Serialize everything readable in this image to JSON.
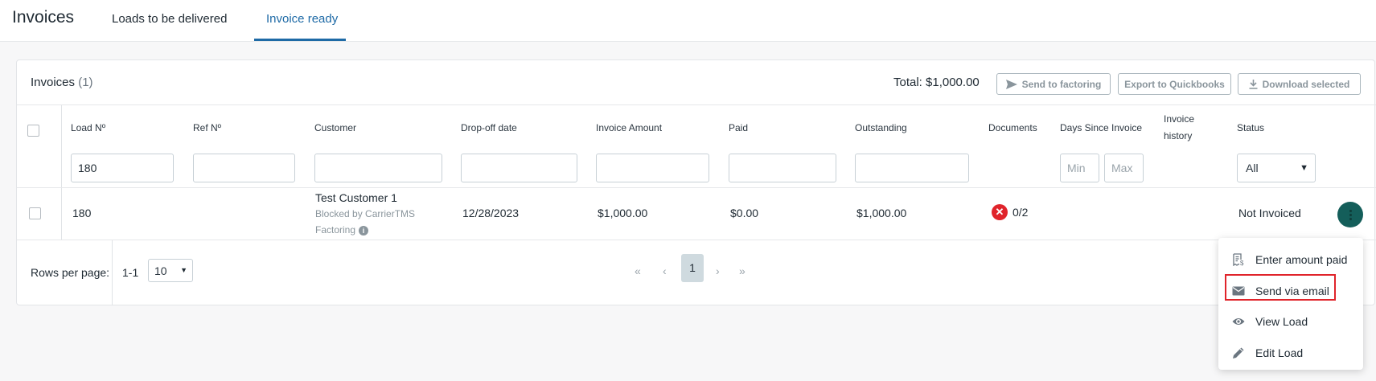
{
  "header": {
    "title": "Invoices",
    "tabs": [
      {
        "label": "Loads to be delivered",
        "active": false
      },
      {
        "label": "Invoice ready",
        "active": true
      }
    ]
  },
  "card": {
    "title": "Invoices",
    "count": "(1)",
    "total": "Total: $1,000.00",
    "buttons": {
      "send_to_factoring": "Send to factoring",
      "export_quickbooks": "Export to Quickbooks",
      "download_selected": "Download selected"
    }
  },
  "table": {
    "columns": {
      "load_no": "Load Nº",
      "ref_no": "Ref Nº",
      "customer": "Customer",
      "dropoff": "Drop-off date",
      "invoice_amount": "Invoice Amount",
      "paid": "Paid",
      "outstanding": "Outstanding",
      "documents": "Documents",
      "days_since": "Days Since Invoice",
      "history_line1": "Invoice",
      "history_line2": "history",
      "status": "Status"
    },
    "filters": {
      "load_no": "180",
      "ref_no": "",
      "customer": "",
      "dropoff": "",
      "invoice_amount": "",
      "paid": "",
      "outstanding": "",
      "days_min_placeholder": "Min",
      "days_max_placeholder": "Max",
      "status": "All"
    },
    "rows": [
      {
        "load_no": "180",
        "ref_no": "",
        "customer": "Test Customer 1",
        "customer_sub": "Blocked by CarrierTMS",
        "customer_sub2": "Factoring",
        "dropoff": "12/28/2023",
        "invoice_amount": "$1,000.00",
        "paid": "$0.00",
        "outstanding": "$1,000.00",
        "documents": "0/2",
        "status": "Not Invoiced"
      }
    ]
  },
  "footer": {
    "rows_per_page_label": "Rows per page:",
    "range": "1-1",
    "rows_per_page_value": "10",
    "pager": {
      "first": "«",
      "prev": "‹",
      "current": "1",
      "next": "›",
      "last": "»"
    }
  },
  "context_menu": {
    "items": [
      {
        "label": "Enter amount paid",
        "icon": "receipt-dollar-icon"
      },
      {
        "label": "Send via email",
        "icon": "envelope-icon"
      },
      {
        "label": "View Load",
        "icon": "eye-icon"
      },
      {
        "label": "Edit Load",
        "icon": "pencil-icon"
      }
    ]
  },
  "colors": {
    "accent": "#1e6aa6",
    "kebab": "#145e5a",
    "error": "#e0242b"
  }
}
